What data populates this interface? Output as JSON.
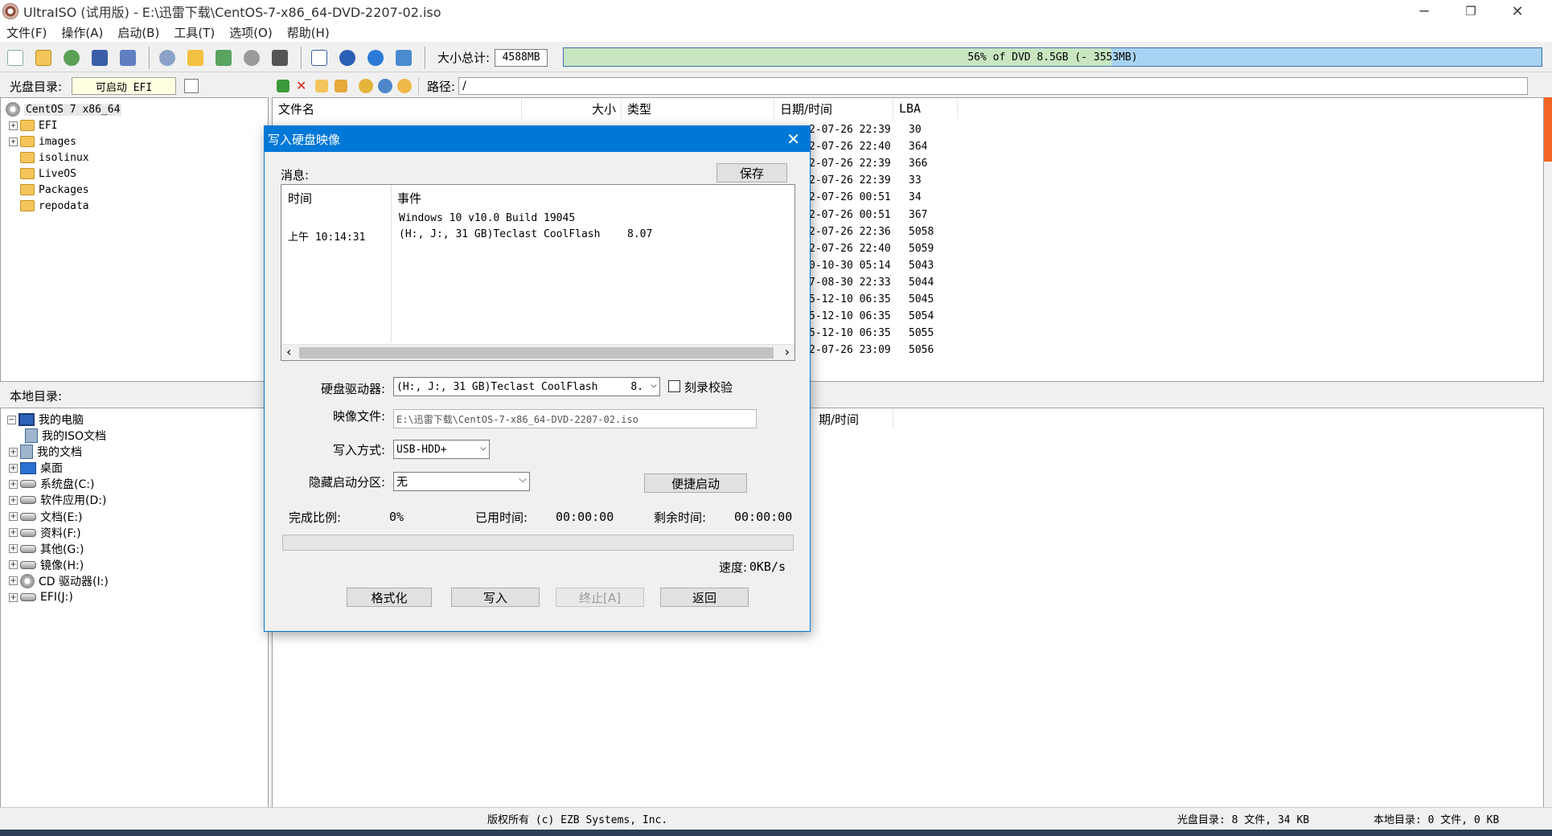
{
  "window": {
    "title": "UltraISO (试用版) - E:\\迅雷下载\\CentOS-7-x86_64-DVD-2207-02.iso",
    "minimize": "─",
    "maximize": "❐",
    "close": "✕"
  },
  "menu": [
    "文件(F)",
    "操作(A)",
    "启动(B)",
    "工具(T)",
    "选项(O)",
    "帮助(H)"
  ],
  "toolbar": {
    "size_label": "大小总计:",
    "size_value": "4588MB",
    "capacity_text": "56% of DVD 8.5GB (- 3553MB)",
    "capacity_percent": 56
  },
  "iso_pane": {
    "label": "光盘目录:",
    "boot_label": "可启动 EFI",
    "path_label": "路径:",
    "path_value": "/",
    "tree": {
      "root": "CentOS 7 x86_64",
      "items": [
        "EFI",
        "images",
        "isolinux",
        "LiveOS",
        "Packages",
        "repodata"
      ]
    },
    "columns": [
      "文件名",
      "大小",
      "类型",
      "日期/时间",
      "LBA"
    ],
    "rows": [
      {
        "date": "2-07-26 22:39",
        "lba": "30"
      },
      {
        "date": "2-07-26 22:40",
        "lba": "364"
      },
      {
        "date": "2-07-26 22:39",
        "lba": "366"
      },
      {
        "date": "2-07-26 22:39",
        "lba": "33"
      },
      {
        "date": "2-07-26 00:51",
        "lba": "34"
      },
      {
        "date": "2-07-26 00:51",
        "lba": "367"
      },
      {
        "date": "2-07-26 22:36",
        "lba": "5058"
      },
      {
        "date": "2-07-26 22:40",
        "lba": "5059"
      },
      {
        "date": "0-10-30 05:14",
        "lba": "5043"
      },
      {
        "date": "7-08-30 22:33",
        "lba": "5044"
      },
      {
        "date": "5-12-10 06:35",
        "lba": "5045"
      },
      {
        "date": "5-12-10 06:35",
        "lba": "5054"
      },
      {
        "date": "5-12-10 06:35",
        "lba": "5055"
      },
      {
        "date": "2-07-26 23:09",
        "lba": "5056"
      }
    ]
  },
  "local_pane": {
    "label": "本地目录:",
    "date_col": "期/时间",
    "tree": {
      "root": "我的电脑",
      "items": [
        "我的ISO文档",
        "我的文档",
        "桌面",
        "系统盘(C:)",
        "软件应用(D:)",
        "文档(E:)",
        "资料(F:)",
        "其他(G:)",
        "镜像(H:)",
        "CD 驱动器(I:)",
        "EFI(J:)"
      ]
    }
  },
  "dialog": {
    "title": "写入硬盘映像",
    "close": "✕",
    "msg_label": "消息:",
    "save_btn": "保存",
    "log_col_time": "时间",
    "log_col_event": "事件",
    "log_line1_event": "Windows 10 v10.0 Build 19045",
    "log_line2_time": "上午 10:14:31",
    "log_line2_event": "(H:, J:, 31 GB)Teclast CoolFlash",
    "log_line2_value": "8.07",
    "scroll_left": "‹",
    "scroll_right": "›",
    "drive_label": "硬盘驱动器:",
    "drive_value": "(H:, J:, 31 GB)Teclast CoolFlash",
    "drive_value_suffix": "8.",
    "verify_label": "刻录校验",
    "image_label": "映像文件:",
    "image_value": "E:\\迅雷下载\\CentOS-7-x86_64-DVD-2207-02.iso",
    "write_mode_label": "写入方式:",
    "write_mode_value": "USB-HDD+",
    "hidden_label": "隐藏启动分区:",
    "hidden_value": "无",
    "quick_boot_btn": "便捷启动",
    "progress_label": "完成比例:",
    "progress_value": "0%",
    "elapsed_label": "已用时间:",
    "elapsed_value": "00:00:00",
    "remaining_label": "剩余时间:",
    "remaining_value": "00:00:00",
    "speed_label": "速度:",
    "speed_value": "0KB/s",
    "format_btn": "格式化",
    "write_btn": "写入",
    "stop_btn": "终止[A]",
    "back_btn": "返回"
  },
  "status": {
    "copyright": "版权所有 (c) EZB Systems, Inc.",
    "iso_info": "光盘目录: 8 文件, 34 KB",
    "local_info": "本地目录: 0 文件, 0 KB"
  }
}
